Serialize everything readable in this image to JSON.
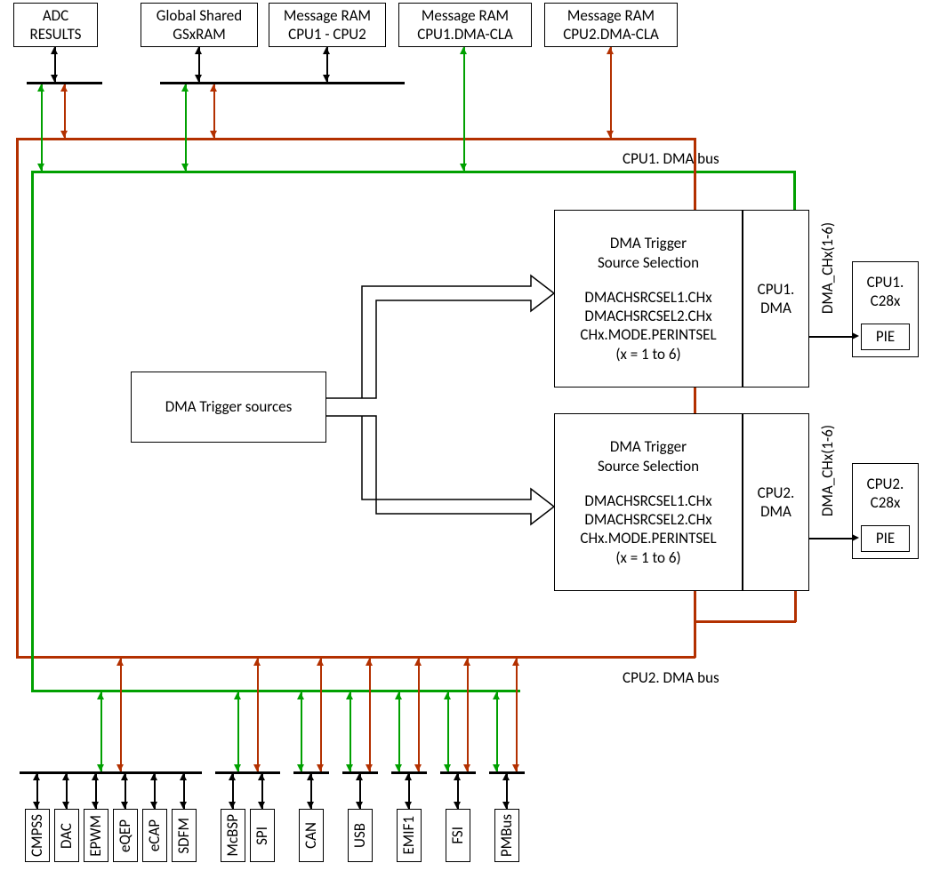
{
  "top_boxes": [
    {
      "l1": "ADC",
      "l2": "RESULTS"
    },
    {
      "l1": "Global Shared",
      "l2": "GSxRAM"
    },
    {
      "l1": "Message RAM",
      "l2": "CPU1 - CPU2"
    },
    {
      "l1": "Message RAM",
      "l2": "CPU1.DMA-CLA"
    },
    {
      "l1": "Message RAM",
      "l2": "CPU2.DMA-CLA"
    }
  ],
  "bus": {
    "cpu1": "CPU1. DMA bus",
    "cpu2": "CPU2. DMA bus"
  },
  "trigger_src": "DMA Trigger sources",
  "sel": {
    "title": "DMA Trigger\nSource Selection",
    "l1": "DMACHSRCSEL1.CHx",
    "l2": "DMACHSRCSEL2.CHx",
    "l3": "CHx.MODE.PERINTSEL",
    "l4": "(x = 1 to 6)"
  },
  "dma": {
    "cpu1": "CPU1.\nDMA",
    "cpu2": "CPU2.\nDMA"
  },
  "ch": "DMA_CHx(1-6)",
  "cpu": {
    "c1": "CPU1.\nC28x",
    "c2": "CPU2.\nC28x",
    "pie": "PIE"
  },
  "periph": [
    "CMPSS",
    "DAC",
    "EPWM",
    "eQEP",
    "eCAP",
    "SDFM",
    "McBSP",
    "SPI",
    "CAN",
    "USB",
    "EMIF1",
    "FSI",
    "PMBus"
  ]
}
